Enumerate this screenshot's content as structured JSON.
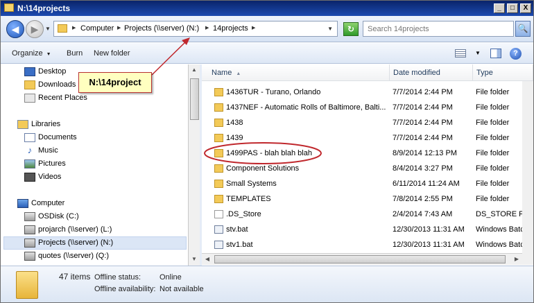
{
  "window": {
    "title": "N:\\14projects",
    "minimize": "_",
    "maximize": "□",
    "close": "X"
  },
  "address": {
    "back_symbol": "◀",
    "forward_symbol": "▶",
    "crumbs": [
      "Computer",
      "Projects (\\\\server) (N:)",
      "14projects"
    ],
    "search_placeholder": "Search 14projects",
    "refresh_symbol": "↻",
    "search_symbol": "🔍"
  },
  "toolbar": {
    "organize": "Organize",
    "burn": "Burn",
    "new_folder": "New folder",
    "help": "?"
  },
  "nav": {
    "favorites": [
      {
        "label": "Desktop",
        "icon": "desktop-icon"
      },
      {
        "label": "Downloads",
        "icon": "folder-icon"
      },
      {
        "label": "Recent Places",
        "icon": "recent-places-icon"
      }
    ],
    "libraries": {
      "label": "Libraries",
      "icon": "libraries-icon"
    },
    "library_items": [
      {
        "label": "Documents",
        "icon": "documents-icon"
      },
      {
        "label": "Music",
        "icon": "music-icon"
      },
      {
        "label": "Pictures",
        "icon": "pictures-icon"
      },
      {
        "label": "Videos",
        "icon": "videos-icon"
      }
    ],
    "computer": {
      "label": "Computer",
      "icon": "computer-icon"
    },
    "drives": [
      {
        "label": "OSDisk (C:)",
        "icon": "disk-icon"
      },
      {
        "label": "projarch (\\\\server) (L:)",
        "icon": "network-drive-icon"
      },
      {
        "label": "Projects (\\\\server) (N:)",
        "icon": "network-drive-icon",
        "selected": true
      },
      {
        "label": "quotes (\\\\server) (Q:)",
        "icon": "network-drive-icon"
      }
    ]
  },
  "columns": {
    "name": "Name",
    "date": "Date modified",
    "type": "Type"
  },
  "files": [
    {
      "name": "1436TUR - Turano, Orlando",
      "date": "7/7/2014 2:44 PM",
      "type": "File folder",
      "kind": "folder"
    },
    {
      "name": "1437NEF - Automatic Rolls of Baltimore, Balti...",
      "date": "7/7/2014 2:44 PM",
      "type": "File folder",
      "kind": "folder"
    },
    {
      "name": "1438",
      "date": "7/7/2014 2:44 PM",
      "type": "File folder",
      "kind": "folder"
    },
    {
      "name": "1439",
      "date": "7/7/2014 2:44 PM",
      "type": "File folder",
      "kind": "folder"
    },
    {
      "name": "1499PAS - blah blah blah",
      "date": "8/9/2014 12:13 PM",
      "type": "File folder",
      "kind": "folder"
    },
    {
      "name": "Component Solutions",
      "date": "8/4/2014 3:27 PM",
      "type": "File folder",
      "kind": "folder"
    },
    {
      "name": "Small Systems",
      "date": "6/11/2014 11:24 AM",
      "type": "File folder",
      "kind": "folder"
    },
    {
      "name": "TEMPLATES",
      "date": "7/8/2014 2:55 PM",
      "type": "File folder",
      "kind": "folder"
    },
    {
      "name": ".DS_Store",
      "date": "2/4/2014 7:43 AM",
      "type": "DS_STORE File",
      "kind": "file"
    },
    {
      "name": "stv.bat",
      "date": "12/30/2013 11:31 AM",
      "type": "Windows Batch File",
      "kind": "bat"
    },
    {
      "name": "stv1.bat",
      "date": "12/30/2013 11:31 AM",
      "type": "Windows Batch File",
      "kind": "bat"
    }
  ],
  "status": {
    "count": "47 items",
    "offline_status_label": "Offline status:",
    "offline_status_value": "Online",
    "offline_avail_label": "Offline availability:",
    "offline_avail_value": "Not available"
  },
  "callout": {
    "text": "N:\\14project",
    "color": "#c0282d"
  }
}
